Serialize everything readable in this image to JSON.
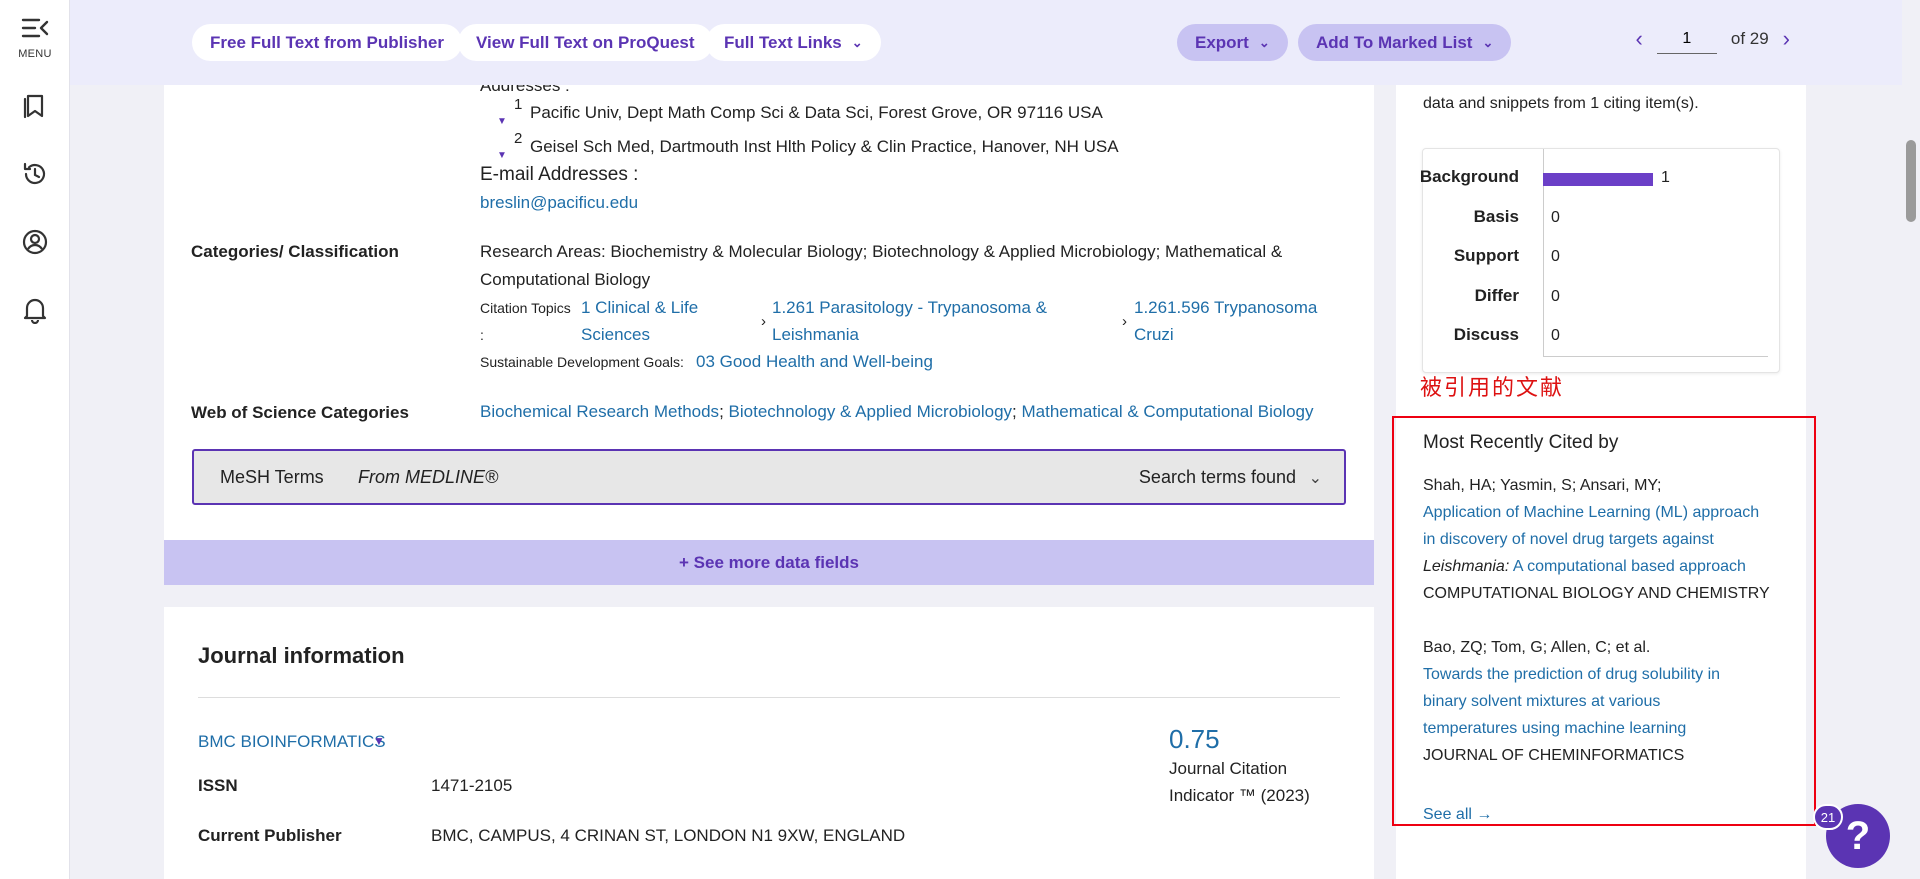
{
  "rail": {
    "menu_label": "MENU"
  },
  "topbar": {
    "free_full_text": "Free Full Text from Publisher",
    "view_proquest": "View Full Text on ProQuest",
    "full_text_links": "Full Text Links",
    "export": "Export",
    "add_marked_list": "Add To Marked List",
    "pager": {
      "current": "1",
      "of_label": "of 29"
    }
  },
  "record": {
    "addresses_label": "Addresses :",
    "addresses": [
      {
        "num": "1",
        "text": "Pacific Univ, Dept Math Comp Sci & Data Sci, Forest Grove, OR 97116 USA"
      },
      {
        "num": "2",
        "text": "Geisel Sch Med, Dartmouth Inst Hlth Policy & Clin Practice, Hanover, NH USA"
      }
    ],
    "email_label": "E-mail Addresses :",
    "email": "breslin@pacificu.edu",
    "categories_label": "Categories/ Classification",
    "research_areas_line1": "Research Areas: Biochemistry & Molecular Biology; Biotechnology & Applied Microbiology; Mathematical &",
    "research_areas_line2": "Computational Biology",
    "citation_topics_label_1": "Citation Topics",
    "citation_topics_label_2": ":",
    "topic1_line1": "1 Clinical & Life",
    "topic1_line2": "Sciences",
    "topic2_line1": "1.261 Parasitology - Trypanosoma &",
    "topic2_line2": "Leishmania",
    "topic3_line1": "1.261.596 Trypanosoma",
    "topic3_line2": "Cruzi",
    "sdg_label": "Sustainable Development Goals:",
    "sdg_value": "03 Good Health and Well-being",
    "wos_label": "Web of Science Categories",
    "wos_cat1": "Biochemical Research Methods",
    "wos_cat2": "Biotechnology & Applied Microbiology",
    "wos_cat3": "Mathematical & Computational Biology",
    "sep": ";",
    "mesh_title": "MeSH Terms",
    "mesh_source": "From MEDLINE®",
    "mesh_found": "Search terms found",
    "see_more": "+ See more data fields"
  },
  "journal": {
    "title": "Journal information",
    "name": "BMC BIOINFORMATICS",
    "issn_label": "ISSN",
    "issn": "1471-2105",
    "publisher_label": "Current Publisher",
    "publisher": "BMC, CAMPUS, 4 CRINAN ST, LONDON N1 9XW, ENGLAND",
    "jci_value": "0.75",
    "jci_label_1": "Journal Citation",
    "jci_label_2": "Indicator ™ (2023)"
  },
  "sidebar": {
    "snippet_text": "data and snippets from 1 citing item(s).",
    "annotation": "被引用的文献",
    "most_recent_title": "Most Recently Cited by",
    "items": [
      {
        "authors": "Shah, HA; Yasmin, S; Ansari, MY;",
        "title_1": "Application of Machine Learning (ML) approach",
        "title_2": "in discovery of novel drug targets against",
        "title_3_italic": "Leishmania:",
        "title_3_rest": " A computational based approach",
        "journal": "COMPUTATIONAL BIOLOGY AND CHEMISTRY"
      },
      {
        "authors": "Bao, ZQ; Tom, G; Allen, C; et al.",
        "title_1": "Towards the prediction of drug solubility in",
        "title_2": "binary solvent mixtures at various",
        "title_3": "temperatures using machine learning",
        "journal": "JOURNAL OF CHEMINFORMATICS"
      }
    ],
    "see_all": "See all →",
    "help_badge": "21",
    "help_icon": "?"
  },
  "chart_data": {
    "type": "bar",
    "categories": [
      "Background",
      "Basis",
      "Support",
      "Differ",
      "Discuss"
    ],
    "values": [
      1,
      0,
      0,
      0,
      0
    ],
    "title": "",
    "xlabel": "",
    "ylabel": "",
    "xlim": [
      0,
      1
    ],
    "bar_color": "#6b3fc7",
    "orientation": "horizontal"
  }
}
